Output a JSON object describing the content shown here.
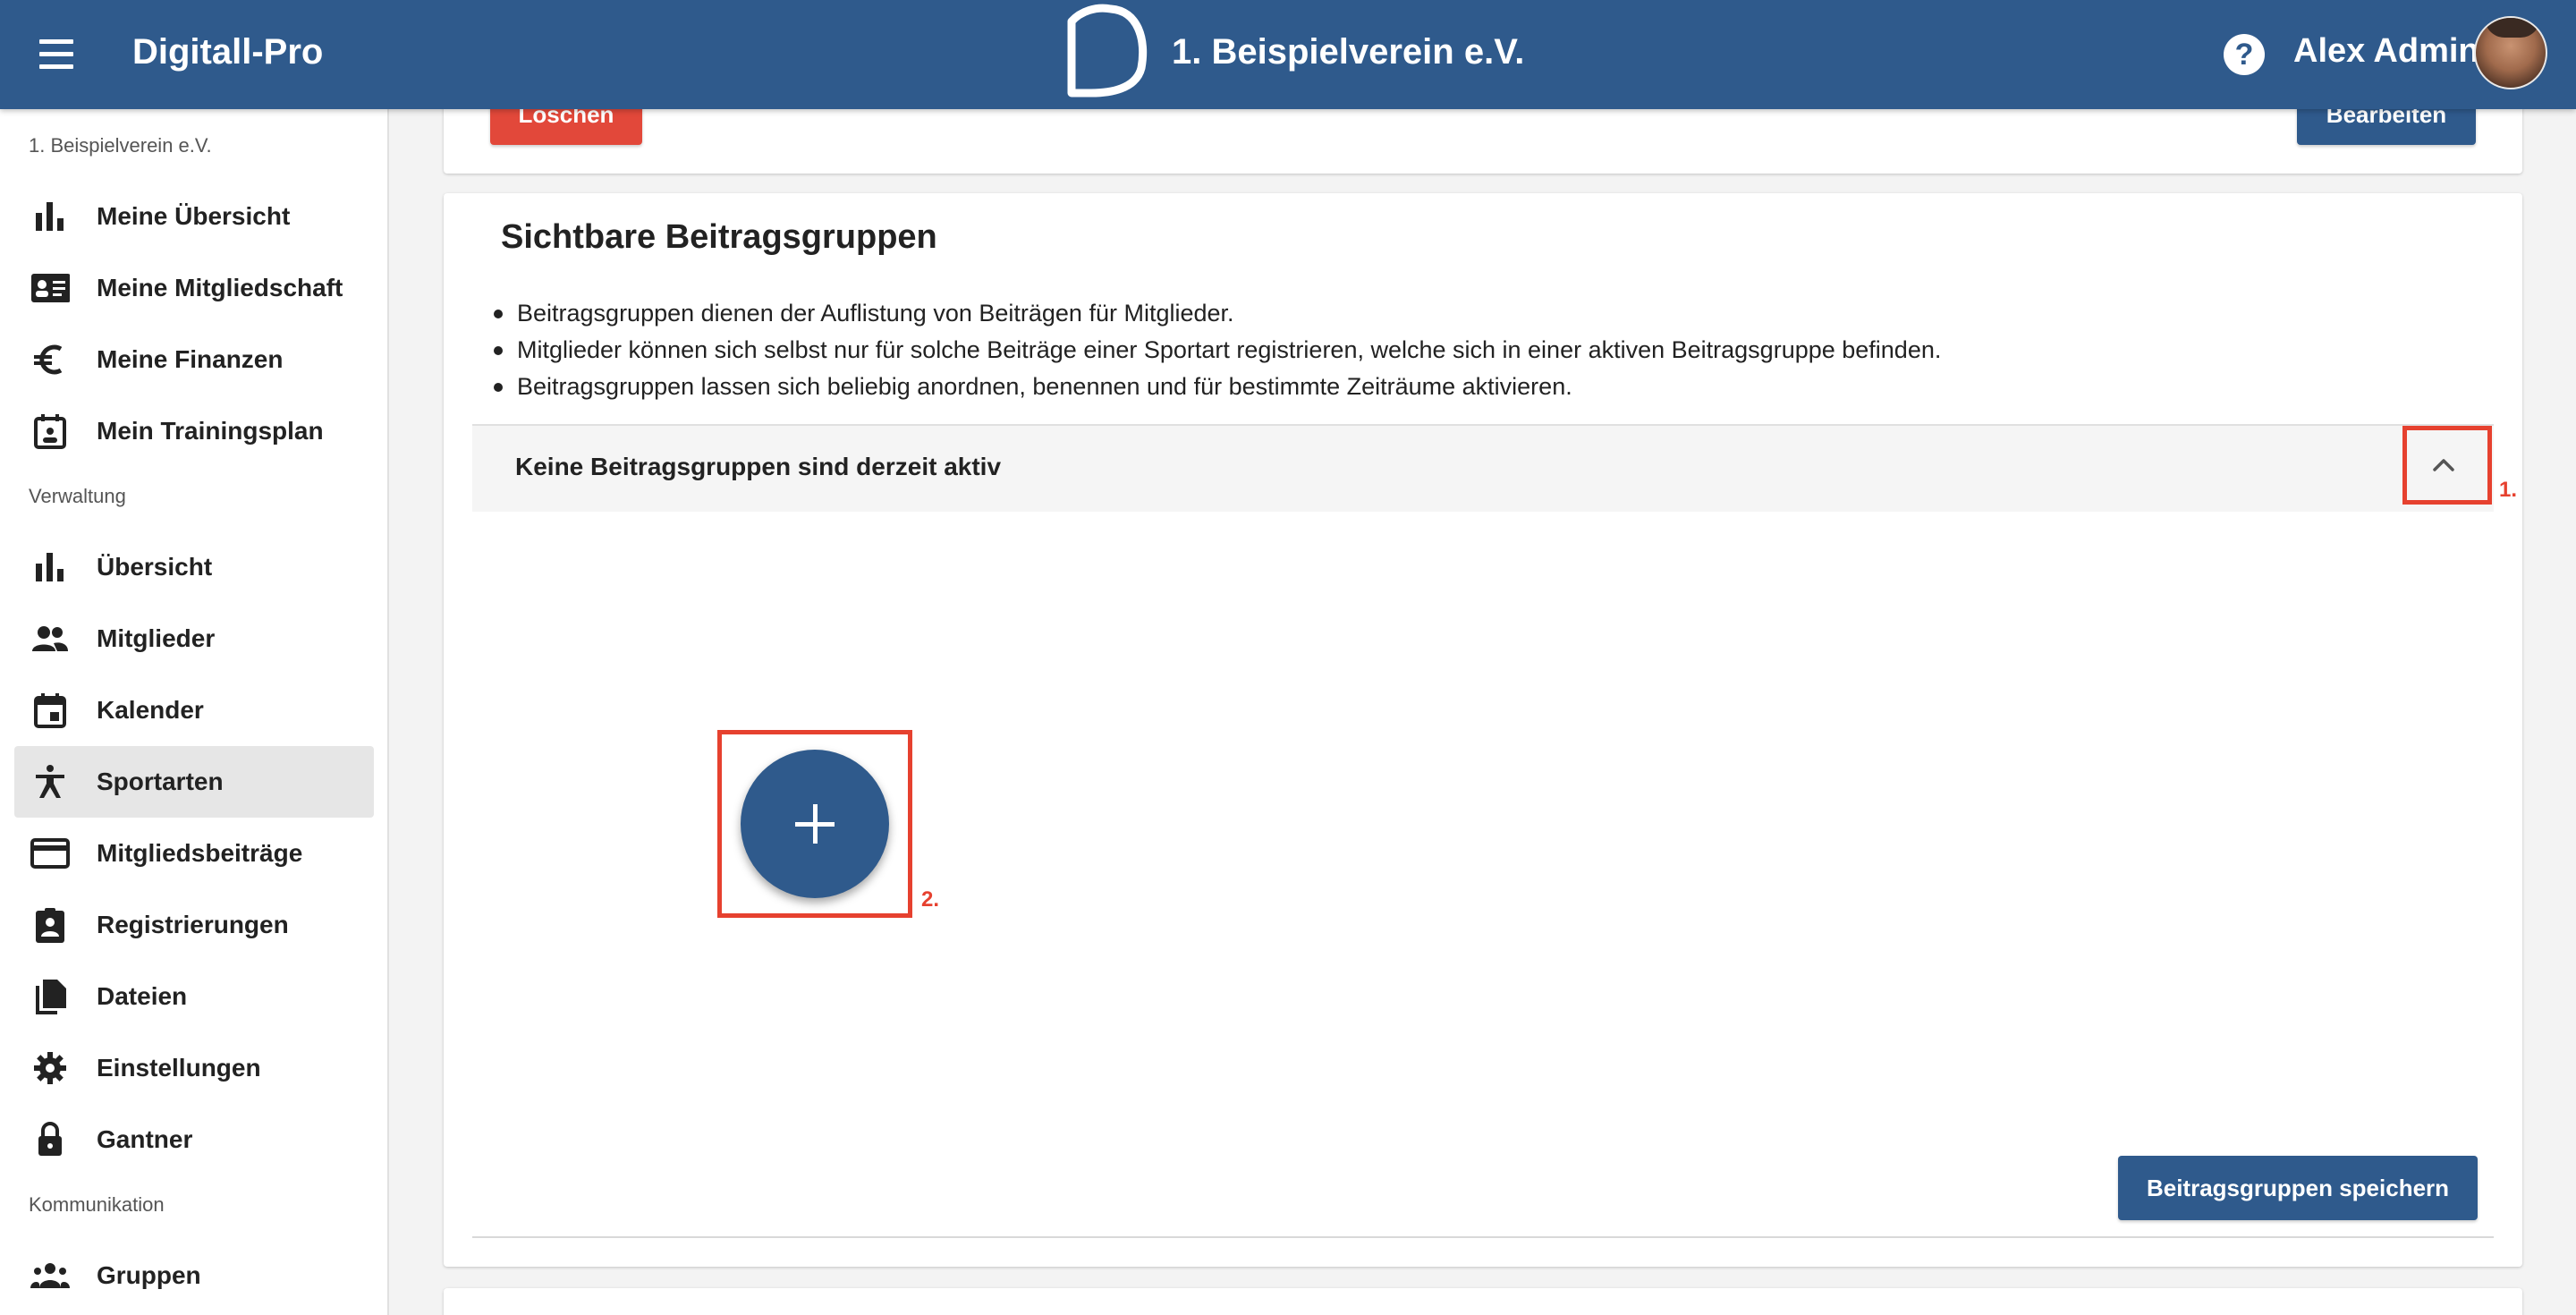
{
  "header": {
    "app_title": "Digitall-Pro",
    "club_title": "1. Beispielverein e.V.",
    "help_label": "?",
    "user_name": "Alex Admin"
  },
  "sidebar": {
    "club_label": "1. Beispielverein e.V.",
    "section_admin": "Verwaltung",
    "section_comm": "Kommunikation",
    "items": [
      {
        "label": "Meine Übersicht",
        "icon": "bar-chart-icon"
      },
      {
        "label": "Meine Mitgliedschaft",
        "icon": "id-card-icon"
      },
      {
        "label": "Meine Finanzen",
        "icon": "euro-icon"
      },
      {
        "label": "Mein Trainingsplan",
        "icon": "calendar-person-icon"
      },
      {
        "label": "Übersicht",
        "icon": "bar-chart-icon"
      },
      {
        "label": "Mitglieder",
        "icon": "people-icon"
      },
      {
        "label": "Kalender",
        "icon": "calendar-icon"
      },
      {
        "label": "Sportarten",
        "icon": "sport-icon"
      },
      {
        "label": "Mitgliedsbeiträge",
        "icon": "credit-card-icon"
      },
      {
        "label": "Registrierungen",
        "icon": "clipboard-person-icon"
      },
      {
        "label": "Dateien",
        "icon": "files-icon"
      },
      {
        "label": "Einstellungen",
        "icon": "gear-icon"
      },
      {
        "label": "Gantner",
        "icon": "lock-icon"
      },
      {
        "label": "Gruppen",
        "icon": "groups-icon"
      }
    ],
    "active_item": "Sportarten"
  },
  "top_card": {
    "delete_label": "Löschen",
    "edit_label": "Bearbeiten"
  },
  "main": {
    "title": "Sichtbare Beitragsgruppen",
    "bullets": [
      "Beitragsgruppen dienen der Auflistung von Beiträgen für Mitglieder.",
      "Mitglieder können sich selbst nur für solche Beiträge einer Sportart registrieren, welche sich in einer aktiven Beitragsgruppe befinden.",
      "Beitragsgruppen lassen sich beliebig anordnen, benennen und für bestimmte Zeiträume aktivieren."
    ],
    "expansion_title": "Keine Beitragsgruppen sind derzeit aktiv",
    "save_label": "Beitragsgruppen speichern"
  },
  "annotations": {
    "step1": "1.",
    "step2": "2.",
    "color": "#e6412f"
  },
  "colors": {
    "primary": "#2f5a8c",
    "danger": "#e2483a"
  }
}
